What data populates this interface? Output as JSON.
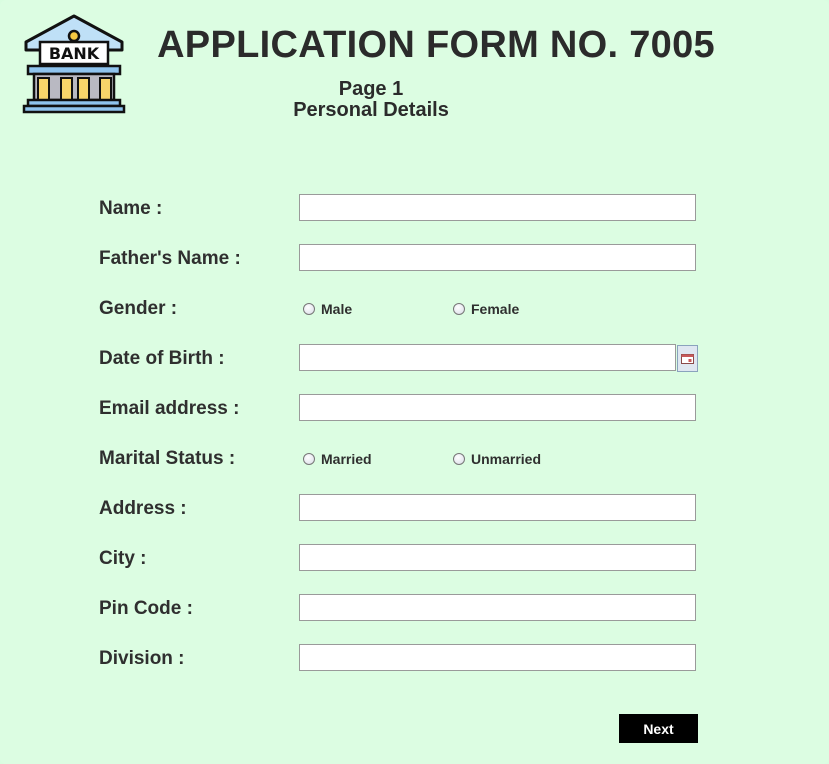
{
  "header": {
    "logo_text": "BANK",
    "title": "APPLICATION FORM NO. 7005",
    "page": "Page 1",
    "section": "Personal Details"
  },
  "form": {
    "name_label": "Name :",
    "name_value": "",
    "father_label": "Father's Name :",
    "father_value": "",
    "gender_label": "Gender :",
    "gender_options": [
      "Male",
      "Female"
    ],
    "dob_label": "Date of Birth :",
    "dob_value": "",
    "email_label": "Email address :",
    "email_value": "",
    "marital_label": "Marital Status :",
    "marital_options": [
      "Married",
      "Unmarried"
    ],
    "address_label": "Address :",
    "address_value": "",
    "city_label": "City :",
    "city_value": "",
    "pin_label": "Pin Code :",
    "pin_value": "",
    "division_label": "Division :",
    "division_value": ""
  },
  "actions": {
    "next_label": "Next"
  },
  "colors": {
    "background": "#dcfde2",
    "button": "#000000",
    "text": "#2f2f2f"
  },
  "icons": {
    "logo": "bank-building-icon",
    "calendar": "calendar-icon"
  }
}
